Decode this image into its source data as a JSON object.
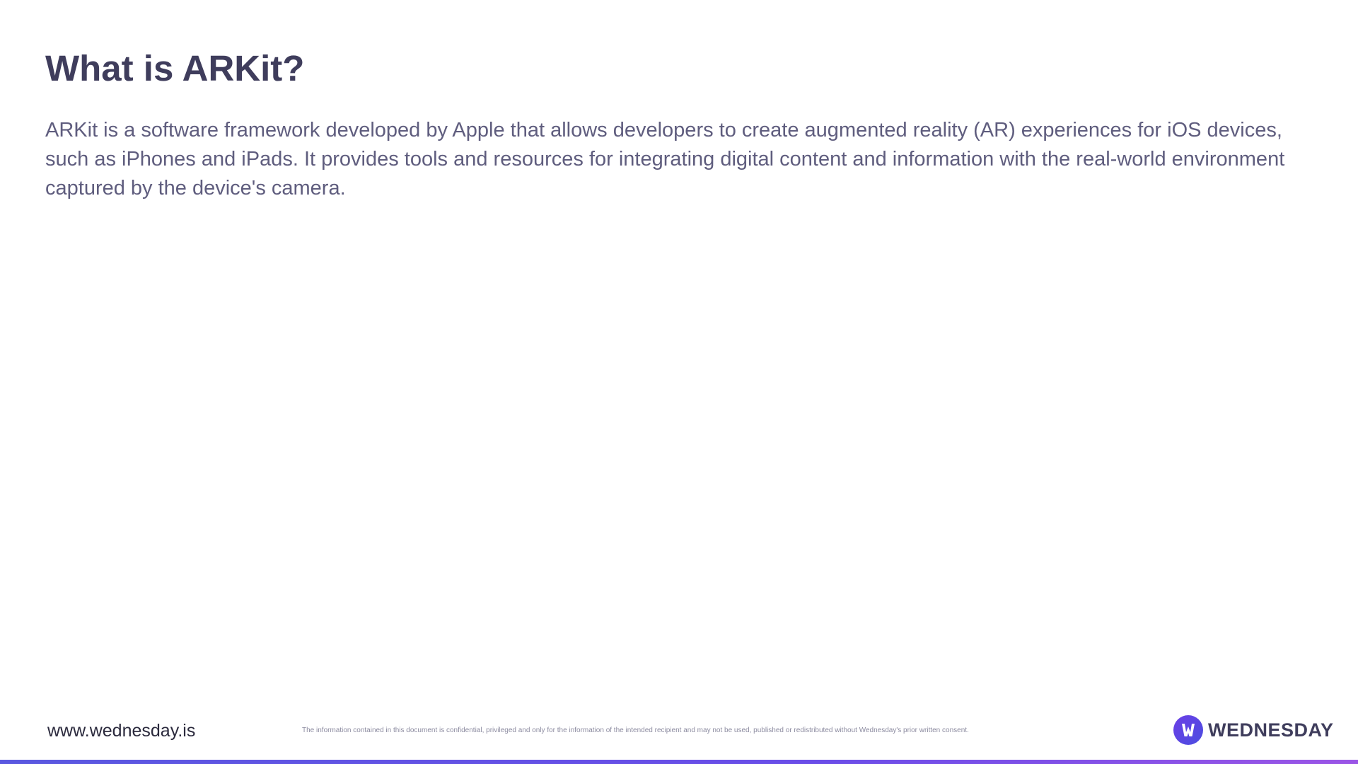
{
  "slide": {
    "title": "What is ARKit?",
    "body": "ARKit is a software framework developed by Apple that allows developers to create augmented reality (AR) experiences for iOS devices, such as iPhones and iPads. It provides tools and resources for integrating digital content and information with the real-world environment captured by the device's camera."
  },
  "footer": {
    "url": "www.wednesday.is",
    "disclaimer": "The information contained in this document is confidential, privileged and only for the information of the intended recipient and may not be used, published or redistributed without Wednesday's prior written consent.",
    "logo_text": "WEDNESDAY",
    "logo_icon": "wednesday-logo-icon"
  },
  "colors": {
    "title": "#3f3d5c",
    "body": "#5f5d7e",
    "accent": "#5a58e0",
    "accent_end": "#9b55e6"
  }
}
